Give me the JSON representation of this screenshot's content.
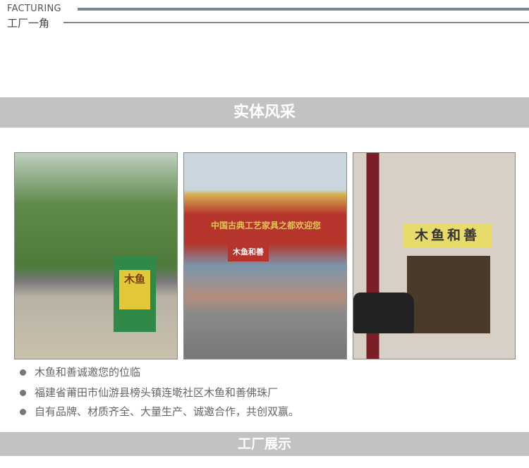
{
  "header": {
    "english": "FACTURING",
    "chinese": "工厂一角"
  },
  "banner_top": "实体风采",
  "photos": [
    {
      "sign": "木鱼"
    },
    {
      "arch_text": "中国古典工艺家具之都欢迎您",
      "billboard": "木鱼和善"
    },
    {
      "sign": "木鱼和善"
    }
  ],
  "bullets": [
    "木鱼和善诚邀您的位临",
    "福建省莆田市仙游县榜头镇连墘社区木鱼和善佛珠厂",
    "自有品牌、材质齐全、大量生产、诚邀合作，共创双赢。"
  ],
  "banner_bottom": "工厂展示",
  "colors": {
    "line": "#7d858d",
    "banner": "#c2c2c2"
  }
}
